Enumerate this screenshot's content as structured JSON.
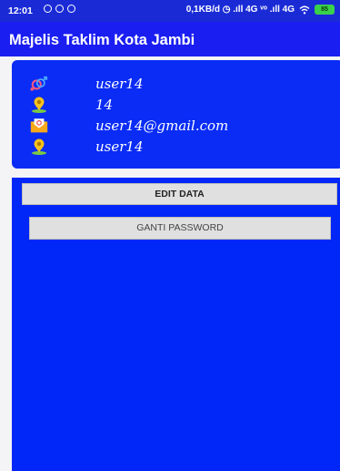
{
  "status_bar": {
    "time": "12:01",
    "right_text": "0,1KB/d ◷ .ıll 4G ᵛᵒ .ıll 4G",
    "battery": "85"
  },
  "app_bar": {
    "title": "Majelis Taklim Kota Jambi"
  },
  "profile": {
    "rows": [
      {
        "icon": "gender-icon",
        "value": "user14"
      },
      {
        "icon": "location-pin-icon",
        "value": "14"
      },
      {
        "icon": "mail-icon",
        "value": "user14@gmail.com"
      },
      {
        "icon": "location-pin-icon",
        "value": "user14"
      }
    ]
  },
  "actions": {
    "edit_label": "EDIT DATA",
    "password_label": "GANTI PASSWORD"
  },
  "colors": {
    "primary": "#1a1ef0",
    "card": "#0a2cf5",
    "panel": "#0027f7"
  }
}
